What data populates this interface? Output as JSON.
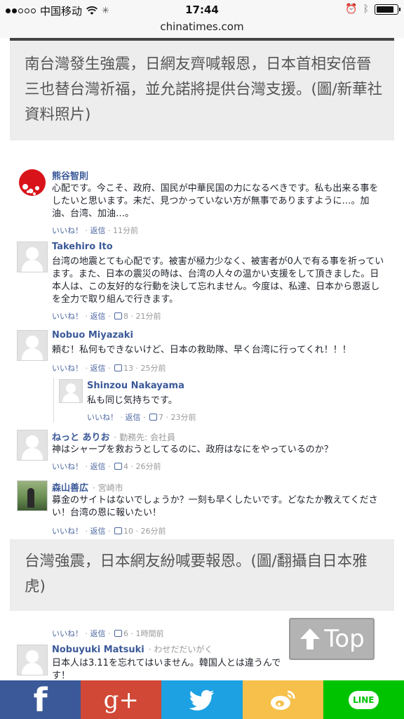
{
  "status_bar": {
    "carrier": "中国移动",
    "time": "17:44",
    "battery_level": 0.85,
    "signal_bars_filled": 2
  },
  "url_bar": {
    "domain": "chinatimes.com"
  },
  "captions": [
    "南台灣發生強震，日網友齊喊報恩，日本首相安倍晉三也替台灣祈福，並允諾將提供台灣支援。(圖/新華社資料照片)",
    "台灣強震，日本網友紛喊要報恩。(圖/翻攝自日本雅虎)"
  ],
  "comments": [
    {
      "name": "熊谷智則",
      "meta": "",
      "text": "心配です。今こそ、政府、国民が中華民国の力になるべきです。私も出来る事をしたいと思います。未だ、見つかっていない方が無事でありますように…。加油、台湾、加油…。",
      "like": "いいね！",
      "reply": "返信",
      "count": "",
      "time": "11分前",
      "avatar": "red-flower-avatar"
    },
    {
      "name": "Takehiro Ito",
      "meta": "",
      "text": "台湾の地震とても心配です。被害が極力少なく、被害者が0人で有る事を祈っています。また、日本の震災の時は、台湾の人々の温かい支援をして頂きました。日本人は、この友好的な行動を決して忘れません。今度は、私達、日本から恩返しを全力で取り組んで行きます。",
      "like": "いいね！",
      "reply": "返信",
      "count": "8",
      "time": "21分前",
      "avatar": "default-avatar"
    },
    {
      "name": "Nobuo Miyazaki",
      "meta": "",
      "text": "頼む！私何もできないけど、日本の救助隊、早く台湾に行ってくれ！！！",
      "like": "いいね！",
      "reply": "返信",
      "count": "13",
      "time": "25分前",
      "avatar": "default-avatar"
    },
    {
      "name": "Shinzou Nakayama",
      "meta": "",
      "text": "私も同じ気持ちです。",
      "like": "いいね！",
      "reply": "返信",
      "count": "7",
      "time": "23分前",
      "avatar": "default-avatar"
    },
    {
      "name": "ねっと ありお",
      "meta": "· 勤務先: 会社員",
      "text": "神はシャープを救おうとしてるのに、政府はなにをやっているのか？",
      "like": "いいね！",
      "reply": "返信",
      "count": "4",
      "time": "26分前",
      "avatar": "default-avatar"
    },
    {
      "name": "森山善広",
      "meta": "· 宮崎市",
      "text": "募金のサイトはないでしょうか？一刻も早くしたいです。どなたか教えてください！台湾の恩に報いたい！",
      "like": "いいね！",
      "reply": "返信",
      "count": "10",
      "time": "26分前",
      "avatar": "photo-avatar"
    },
    {
      "name": "Nobuyuki Matsuki",
      "meta": "· わせだだいがく",
      "text": "日本人は3.11を忘れてはいません。韓国人とは違うんです！",
      "like": "",
      "reply": "",
      "count": "",
      "time": "",
      "avatar": "default-avatar"
    }
  ],
  "orphan_footer": {
    "like": "いいね！",
    "reply": "返信",
    "count": "6",
    "time": "1時間前"
  },
  "back_to_top": {
    "label": "Top",
    "icon": "up-arrow-icon"
  },
  "share_bar": [
    {
      "label": "f",
      "icon": "facebook-icon",
      "color": "#3b5998"
    },
    {
      "label": "g+",
      "icon": "google-plus-icon",
      "color": "#d14836"
    },
    {
      "label": "",
      "icon": "twitter-icon",
      "color": "#1da1e2"
    },
    {
      "label": "",
      "icon": "weibo-icon",
      "color": "#f6c04a"
    },
    {
      "label": "LINE",
      "icon": "line-icon",
      "color": "#00c300"
    }
  ]
}
